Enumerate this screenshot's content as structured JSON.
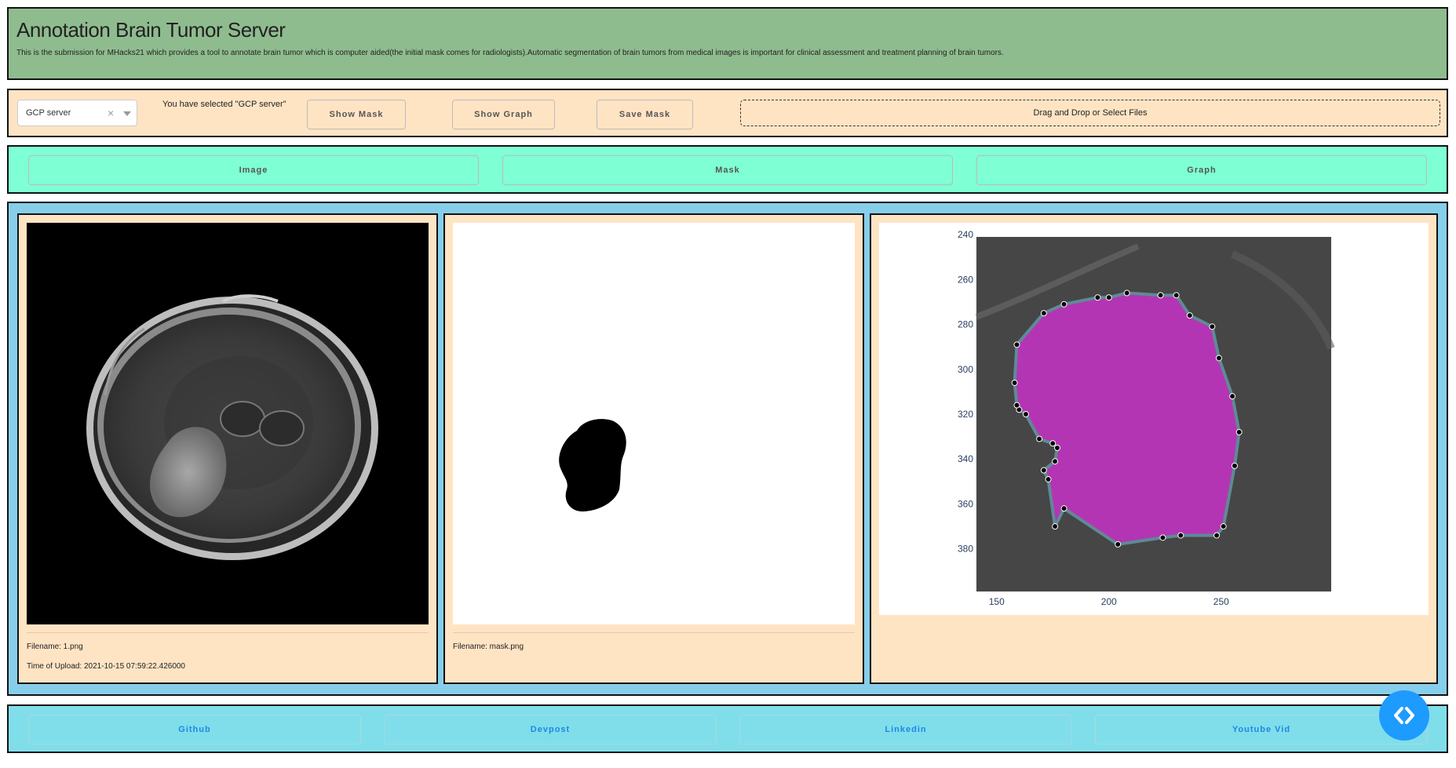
{
  "header": {
    "title": "Annotation Brain Tumor Server",
    "description": "This is the submission for MHacks21 which provides a tool to annotate brain tumor which is computer aided(the initial mask comes for radiologists).Automatic segmentation of brain tumors from medical images is important for clinical assessment and treatment planning of brain tumors."
  },
  "controls": {
    "server_select": {
      "value": "GCP server",
      "clear_icon": "×"
    },
    "selected_text": "You have selected \"GCP server\"",
    "show_mask": "Show Mask",
    "show_graph": "Show Graph",
    "save_mask": "Save Mask",
    "upload_text": "Drag and Drop or Select Files"
  },
  "tabs": [
    "Image",
    "Mask",
    "Graph"
  ],
  "image_card": {
    "filename": "Filename: 1.png",
    "upload_time": "Time of Upload: 2021-10-15 07:59:22.426000"
  },
  "mask_card": {
    "filename": "Filename: mask.png"
  },
  "graph": {
    "y_ticks": [
      "240",
      "260",
      "280",
      "300",
      "320",
      "340",
      "360",
      "380"
    ],
    "x_ticks": [
      "150",
      "200",
      "250"
    ]
  },
  "chart_data": {
    "type": "scatter",
    "title": "",
    "xlabel": "",
    "ylabel": "",
    "xlim": [
      141,
      299
    ],
    "ylim": [
      399,
      241
    ],
    "y_reversed": true,
    "grid": false,
    "series": [
      {
        "x": [
          200,
          208,
          223,
          230,
          236,
          246,
          249,
          255,
          258,
          256,
          251,
          248,
          232,
          224,
          204,
          180,
          176,
          173,
          171,
          176,
          177,
          175,
          169,
          163,
          160,
          159,
          158,
          159,
          171,
          180,
          195
        ],
        "y": [
          268,
          266,
          267,
          267,
          276,
          281,
          295,
          312,
          328,
          343,
          370,
          374,
          374,
          375,
          378,
          362,
          370,
          349,
          345,
          341,
          335,
          333,
          331,
          320,
          318,
          316,
          306,
          289,
          275,
          271,
          268
        ]
      }
    ],
    "colors": {
      "contour": "#5f8a96",
      "fill": "#c832c8",
      "points": "#000000"
    }
  },
  "footer": [
    "Github",
    "Devpost",
    "Linkedin",
    "Youtube Vid"
  ]
}
